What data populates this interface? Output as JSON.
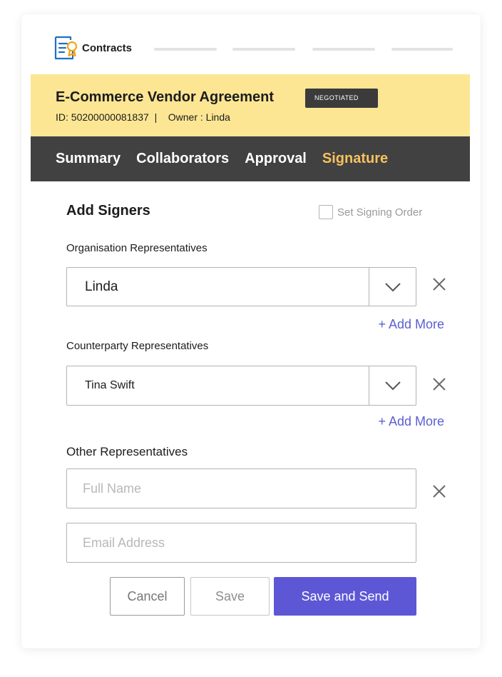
{
  "app": {
    "brand": "Contracts"
  },
  "contract": {
    "title": "E-Commerce Vendor Agreement",
    "status": "NEGOTIATED",
    "meta": "ID: 50200000081837  |    Owner : Linda"
  },
  "tabs": [
    {
      "label": "Summary",
      "active": false
    },
    {
      "label": "Collaborators",
      "active": false
    },
    {
      "label": "Approval",
      "active": false
    },
    {
      "label": "Signature",
      "active": true
    }
  ],
  "form": {
    "title": "Add Signers",
    "signing_order_label": "Set Signing Order",
    "org_label": "Organisation Representatives",
    "org_value": "Linda",
    "counterparty_label": "Counterparty Representatives",
    "counterparty_value": "Tina Swift",
    "add_more_label": "+ Add More",
    "other_label": "Other Representatives",
    "full_name_placeholder": "Full Name",
    "email_placeholder": "Email Address"
  },
  "actions": {
    "cancel_label": "Cancel",
    "save_label": "Save",
    "save_send_label": "Save and Send"
  },
  "colors": {
    "header_bg": "#fde693",
    "tabbar_bg": "#414141",
    "active_tab": "#f6c15f",
    "accent": "#5d57d6",
    "link": "#5b5fd0"
  },
  "icons": {
    "logo": "contract-document-ribbon-icon",
    "select_arrow": "chevron-down-icon",
    "remove": "close-icon"
  }
}
